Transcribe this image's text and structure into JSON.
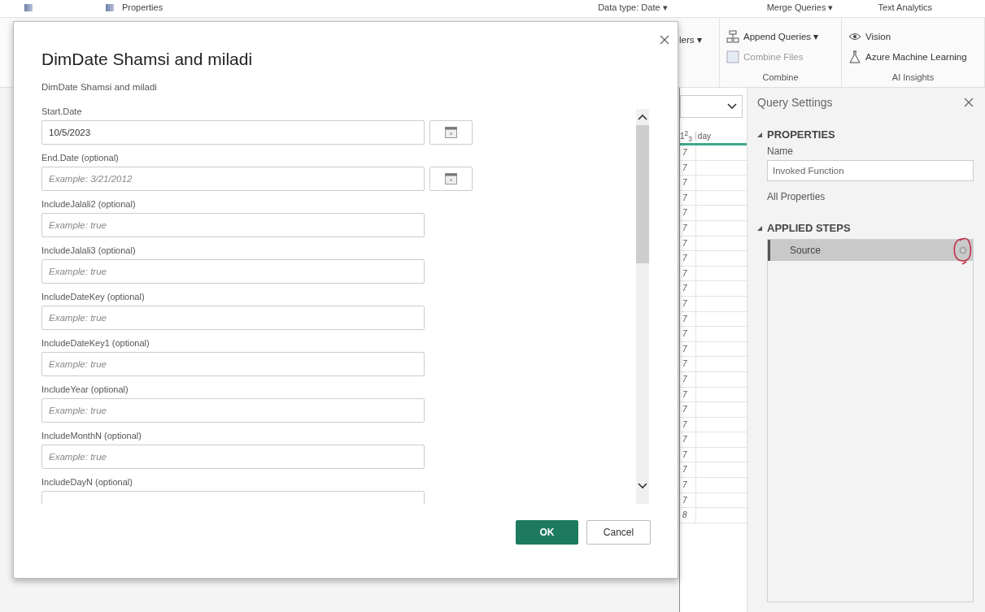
{
  "ribbon": {
    "top_items": [
      "Properties",
      "Data type: Date ▾",
      "Merge Queries ▾",
      "Text Analytics"
    ],
    "partial_button": "lers ▾",
    "combine_group": {
      "buttons": [
        {
          "label": "Append Queries ▾",
          "disabled": false
        },
        {
          "label": "Combine Files",
          "disabled": true
        }
      ],
      "label": "Combine"
    },
    "ai_group": {
      "buttons": [
        "Vision",
        "Azure Machine Learning"
      ],
      "label": "AI Insights"
    }
  },
  "grid": {
    "type_badge": "1$^{2}$$_{3}$",
    "column_header": "day",
    "rows": [
      "7",
      "7",
      "7",
      "7",
      "7",
      "7",
      "7",
      "7",
      "7",
      "7",
      "7",
      "7",
      "7",
      "7",
      "7",
      "7",
      "7",
      "7",
      "7",
      "7",
      "7",
      "7",
      "7",
      "7",
      "8"
    ]
  },
  "dialog": {
    "title": "DimDate Shamsi and miladi",
    "description": "DimDate Shamsi and miladi",
    "fields": [
      {
        "label": "Start.Date",
        "kind": "date",
        "value": "10/5/2023"
      },
      {
        "label": "End.Date (optional)",
        "kind": "date",
        "placeholder": "Example: 3/21/2012"
      },
      {
        "label": "IncludeJalali2 (optional)",
        "kind": "text",
        "placeholder": "Example: true"
      },
      {
        "label": "IncludeJalali3 (optional)",
        "kind": "text",
        "placeholder": "Example: true"
      },
      {
        "label": "IncludeDateKey (optional)",
        "kind": "text",
        "placeholder": "Example: true"
      },
      {
        "label": "IncludeDateKey1 (optional)",
        "kind": "text",
        "placeholder": "Example: true"
      },
      {
        "label": "IncludeYear (optional)",
        "kind": "text",
        "placeholder": "Example: true"
      },
      {
        "label": "IncludeMonthN (optional)",
        "kind": "text",
        "placeholder": "Example: true"
      },
      {
        "label": "IncludeDayN (optional)",
        "kind": "text"
      }
    ],
    "buttons": [
      {
        "label": "OK",
        "kind": "primary"
      },
      {
        "label": "Cancel",
        "kind": "secondary"
      }
    ]
  },
  "query_settings": {
    "title": "Query Settings",
    "properties": {
      "heading": "PROPERTIES",
      "expanded": true,
      "name_label": "Name",
      "name_value": "Invoked Function",
      "all_properties": "All Properties"
    },
    "applied_steps": {
      "heading": "APPLIED STEPS",
      "expanded": true,
      "steps": [
        {
          "label": "Source",
          "selected": true
        }
      ]
    }
  }
}
